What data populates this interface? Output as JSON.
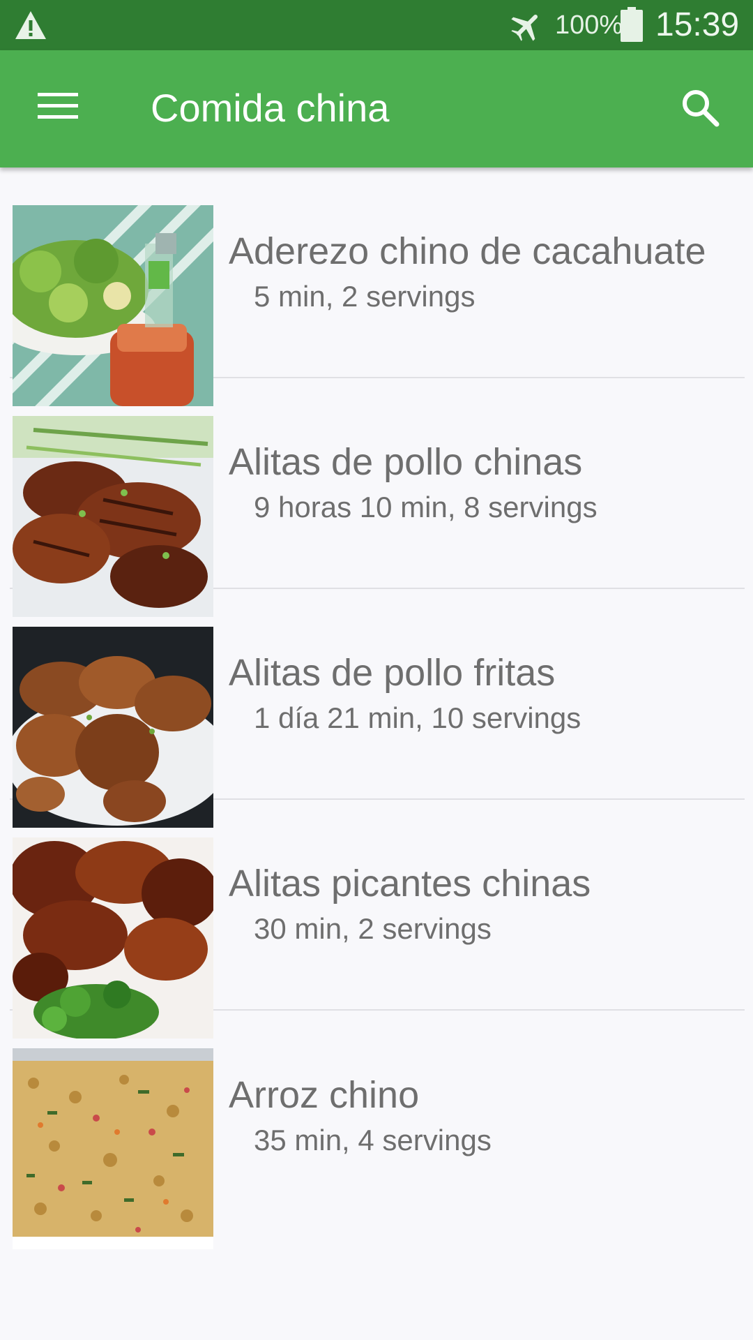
{
  "status_bar": {
    "battery_percent": "100%",
    "time": "15:39",
    "icons": [
      "warning-icon",
      "airplane-mode-icon",
      "battery-icon"
    ]
  },
  "app_bar": {
    "title": "Comida china",
    "icons": [
      "menu-icon",
      "search-icon"
    ],
    "color": "#4caf50"
  },
  "recipes": [
    {
      "name": "Aderezo chino de cacahuate",
      "meta": "5 min, 2 servings"
    },
    {
      "name": "Alitas de pollo chinas",
      "meta": "9 horas 10 min, 8 servings"
    },
    {
      "name": "Alitas de pollo fritas",
      "meta": "1 día 21 min, 10 servings"
    },
    {
      "name": "Alitas picantes chinas",
      "meta": "30 min, 2 servings"
    },
    {
      "name": "Arroz chino",
      "meta": "35 min, 4 servings"
    }
  ]
}
